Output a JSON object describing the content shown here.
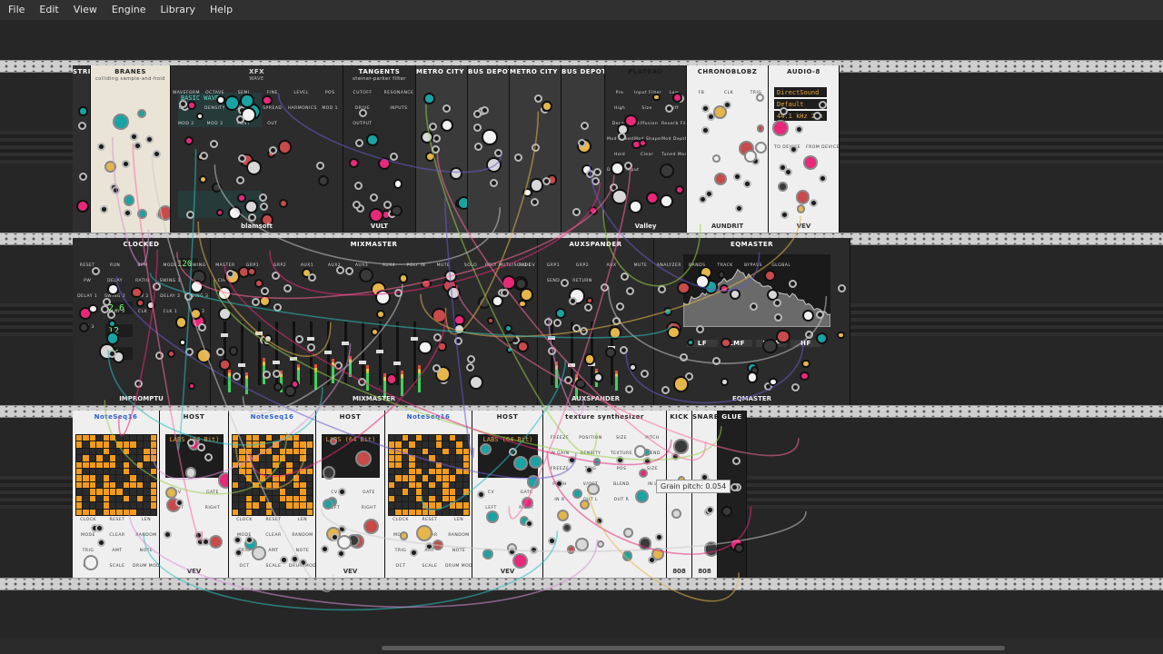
{
  "menu": [
    "File",
    "Edit",
    "View",
    "Engine",
    "Library",
    "Help"
  ],
  "colors": {
    "menubar": "#303030",
    "rack_bg": "#262626",
    "rail": "#cfcfcf",
    "sequencer_on": "#f29a1d",
    "accent_pink": "#e8297a",
    "accent_teal": "#1aa3a3"
  },
  "tooltip": "Grain pitch: 0.054",
  "rows": [
    {
      "modules": [
        {
          "name": "STRIP",
          "panel": "#2f2f2f",
          "text": "#ffffff",
          "footer": ""
        },
        {
          "name": "BRANES",
          "subtitle": "colliding sample-and-hold",
          "panel": "#e9e4d6",
          "text": "#222222",
          "footer": ""
        },
        {
          "name": "XFX",
          "subtitle": "WAVE",
          "panel": "#2c2c2c",
          "text": "#d8d8d8",
          "footer": "blamsoft",
          "display_text": "BASIC WAVES",
          "labels": [
            "WAVEFORM",
            "OCTAVE",
            "SEMI",
            "FINE",
            "LEVEL",
            "POS",
            "NOISE",
            "DENSITY",
            "DETUNE",
            "SPREAD",
            "HARMONICS",
            "MOD 1",
            "MOD 2",
            "MOD 3",
            "POST",
            "OUT"
          ]
        },
        {
          "name": "TANGENTS",
          "subtitle": "steiner-parker filter",
          "panel": "#2a2a2a",
          "text": "#ffffff",
          "footer": "VULT",
          "labels": [
            "CUTOFF",
            "RESONANCE",
            "DRIVE",
            "INPUTS",
            "OUTPUT"
          ]
        },
        {
          "name": "METRO CITY BUS",
          "panel": "#3a3a3a",
          "text": "#ffffff",
          "footer": ""
        },
        {
          "name": "BUS DEPOT",
          "panel": "#3a3a3a",
          "text": "#ffffff",
          "footer": ""
        },
        {
          "name": "METRO CITY BUS",
          "panel": "#3a3a3a",
          "text": "#ffffff",
          "footer": ""
        },
        {
          "name": "BUS DEPOT",
          "panel": "#3a3a3a",
          "text": "#ffffff",
          "footer": ""
        },
        {
          "name": "PLATEAU",
          "panel": "#2c2c2c",
          "text": "#1a1a1a",
          "footer": "Valley",
          "labels": [
            "Pre",
            "Input Filter",
            "Low",
            "High",
            "Size",
            "Diff",
            "Decay",
            "Diffusion",
            "Reverb Filter",
            "Mod Speed",
            "Mod Shape",
            "Mod Depth",
            "Hold",
            "Clear",
            "Tuned Mode",
            "Diffuse Input"
          ]
        },
        {
          "name": "CHRONOBLOBZ",
          "panel": "#efefef",
          "text": "#222222",
          "footer": "AUNDRIT",
          "labels": [
            "FB",
            "CLK",
            "TRIG"
          ]
        },
        {
          "name": "AUDIO-8",
          "panel": "#efefef",
          "text": "#222222",
          "footer": "VEV",
          "display": [
            "DirectSound",
            "Default Device (1-2)",
            "44.1 kHz    2ch"
          ],
          "labels": [
            "TO DEVICE",
            "FROM DEVICE"
          ]
        }
      ]
    },
    {
      "modules": [
        {
          "name": "CLOCKED",
          "panel": "#2a2a2a",
          "text": "#ffffff",
          "footer": "IMPROMPTU",
          "bpm": "120",
          "ratios": [
            "2.6",
            "12",
            "14"
          ],
          "labels": [
            "RESET",
            "RUN",
            "BPM",
            "MODE",
            "SWING",
            "PW",
            "DELAY",
            "RATIO",
            "SWING 1",
            "PW 1",
            "DELAY 1",
            "SWING 2",
            "PW 2",
            "DELAY 2",
            "SWING 3",
            "PW 3",
            "DELAY 3",
            "CLK",
            "CLK 1",
            "CLK 2",
            "CLK 3"
          ]
        },
        {
          "name": "MIXMASTER",
          "panel": "#2b2b2b",
          "text": "#ffffff",
          "footer": "MIXMASTER",
          "labels": [
            "MASTER",
            "GRP1",
            "GRP2",
            "AUX1",
            "AUX2",
            "AUX3",
            "AUX4",
            "POLY IN",
            "MUTE",
            "SOLO",
            "POLY MUTE/SOLO CV",
            "FADE",
            "CHAIN"
          ]
        },
        {
          "name": "AUXSPANDER",
          "panel": "#2b2b2b",
          "text": "#ffffff",
          "footer": "AUXSPANDER",
          "labels": [
            "GRP1",
            "GRP2",
            "AUX",
            "MUTE",
            "SEND",
            "RETURN"
          ]
        },
        {
          "name": "EQMASTER",
          "panel": "#2b2b2b",
          "text": "#ffffff",
          "footer": "EQMASTER",
          "labels": [
            "ANALYZER",
            "BANDS",
            "TRACK",
            "BYPASS",
            "GLOBAL"
          ],
          "bands": [
            "LF",
            "LMF",
            "HMF",
            "HF"
          ]
        }
      ]
    },
    {
      "modules": [
        {
          "name": "NoteSeq16",
          "panel": "#efefef",
          "text": "#2a5fd0",
          "footer": "",
          "labels": [
            "CLOCK",
            "RESET",
            "LEN",
            "MODE",
            "CLEAR",
            "RANDOM",
            "TRIG",
            "AMT",
            "NOTE",
            "OCT",
            "SCALE",
            "DRUM MODE",
            "POLY OUT"
          ]
        },
        {
          "name": "HOST",
          "panel": "#efefef",
          "text": "#222222",
          "footer": "VEV",
          "display": "LABS (64 Bit)",
          "labels": [
            "CV",
            "GATE",
            "LEFT",
            "RIGHT"
          ]
        },
        {
          "name": "NoteSeq16",
          "panel": "#efefef",
          "text": "#2a5fd0",
          "footer": "",
          "labels": [
            "CLOCK",
            "RESET",
            "LEN",
            "MODE",
            "CLEAR",
            "RANDOM",
            "TRIG",
            "AMT",
            "NOTE",
            "OCT",
            "SCALE",
            "DRUM MODE",
            "POLY OUT"
          ]
        },
        {
          "name": "HOST",
          "panel": "#efefef",
          "text": "#222222",
          "footer": "VEV",
          "display": "LABS (64 Bit)",
          "labels": [
            "CV",
            "GATE",
            "LEFT",
            "RIGHT"
          ]
        },
        {
          "name": "NoteSeq16",
          "panel": "#efefef",
          "text": "#2a5fd0",
          "footer": "",
          "labels": [
            "CLOCK",
            "RESET",
            "LEN",
            "MODE",
            "CLEAR",
            "RANDOM",
            "TRIG",
            "AMT",
            "NOTE",
            "OCT",
            "SCALE",
            "DRUM MODE",
            "POLY OUT"
          ]
        },
        {
          "name": "HOST",
          "panel": "#efefef",
          "text": "#222222",
          "footer": "VEV",
          "display": "LABS (64 Bit)",
          "labels": [
            "CV",
            "GATE",
            "LEFT",
            "RIGHT"
          ]
        },
        {
          "name": "texture synthesizer",
          "panel": "#efefef",
          "text": "#222222",
          "footer": "",
          "labels": [
            "FREEZE",
            "POSITION",
            "SIZE",
            "PITCH",
            "IN GAIN",
            "DENSITY",
            "TEXTURE",
            "BLEND",
            "FREEZE",
            "TRIG",
            "POS",
            "SIZE",
            "PITCH",
            "V/OCT",
            "BLEND",
            "IN L",
            "IN R",
            "OUT L",
            "OUT R"
          ]
        },
        {
          "name": "KICK",
          "panel": "#efefef",
          "text": "#222222",
          "footer": "808"
        },
        {
          "name": "SNARE",
          "panel": "#efefef",
          "text": "#222222",
          "footer": "808"
        },
        {
          "name": "GLUE",
          "panel": "#1f1f1f",
          "text": "#ffffff",
          "footer": ""
        }
      ]
    }
  ]
}
